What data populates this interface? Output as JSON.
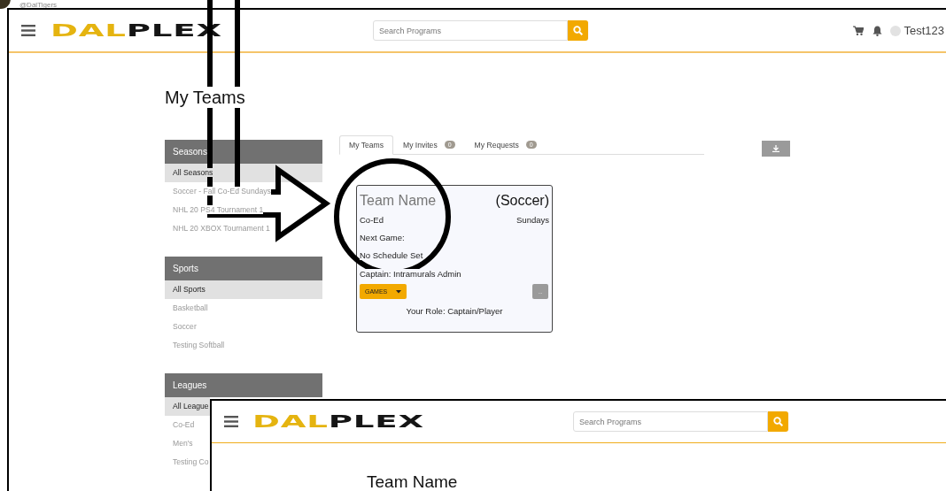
{
  "background_window": {
    "handle": "@DalTigers"
  },
  "main_window": {
    "header": {
      "logo_left": "DAL",
      "logo_right": "PLEX",
      "search_placeholder": "Search Programs",
      "user": "Test123"
    },
    "page_title": "My Teams",
    "sidebar": [
      {
        "title": "Seasons",
        "items": [
          {
            "label": "All Seasons",
            "selected": true
          },
          {
            "label": "Soccer - Fall Co-Ed Sundays",
            "selected": false
          },
          {
            "label": "NHL 20 PS4 Tournament 1",
            "selected": false
          },
          {
            "label": "NHL 20 XBOX Tournament 1",
            "selected": false
          }
        ]
      },
      {
        "title": "Sports",
        "items": [
          {
            "label": "All Sports",
            "selected": true
          },
          {
            "label": "Basketball",
            "selected": false
          },
          {
            "label": "Soccer",
            "selected": false
          },
          {
            "label": "Testing Softball",
            "selected": false
          }
        ]
      },
      {
        "title": "Leagues",
        "items": [
          {
            "label": "All League",
            "selected": true
          },
          {
            "label": "Co-Ed",
            "selected": false
          },
          {
            "label": "Men's",
            "selected": false
          },
          {
            "label": "Testing Co",
            "selected": false
          }
        ]
      }
    ],
    "tabs": [
      {
        "label": "My Teams",
        "selected": true
      },
      {
        "label": "My Invites",
        "badge": "0",
        "selected": false
      },
      {
        "label": "My Requests",
        "badge": "0",
        "selected": false
      }
    ],
    "team_card": {
      "name": "Team Name",
      "sport": "(Soccer)",
      "league": "Co-Ed",
      "day": "Sundays",
      "next_game_label": "Next Game:",
      "schedule": "No Schedule Set",
      "captain": "Captain: Intramurals Admin",
      "games_button": "GAMES",
      "more_button": "...",
      "role": "Your Role: Captain/Player"
    }
  },
  "overlay_window": {
    "header": {
      "logo_left": "DAL",
      "logo_right": "PLEX",
      "search_placeholder": "Search Programs"
    },
    "page_title": "Team Name"
  }
}
